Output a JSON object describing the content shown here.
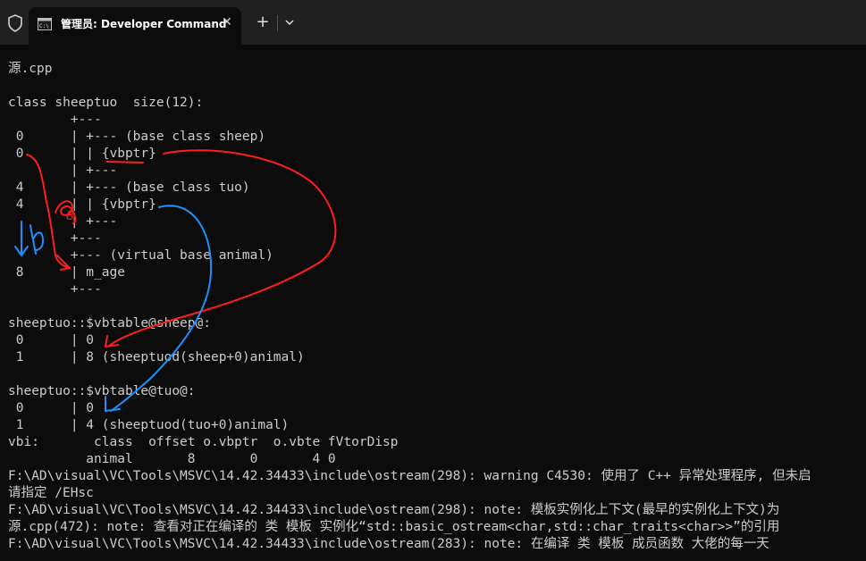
{
  "tab": {
    "title": "管理员: Developer Command",
    "close_glyph": "✕",
    "new_tab_glyph": "+"
  },
  "console_lines": [
    "",
    "源.cpp",
    "",
    "class sheeptuo  size(12):",
    "        +---",
    " 0      | +--- (base class sheep)",
    " 0      | | {vbptr}",
    "        | +---",
    " 4      | +--- (base class tuo)",
    " 4      | | {vbptr}",
    "        | +---",
    "        +---",
    "        +--- (virtual base animal)",
    " 8      | m_age",
    "        +---",
    "",
    "sheeptuo::$vbtable@sheep@:",
    " 0      | 0",
    " 1      | 8 (sheeptuod(sheep+0)animal)",
    "",
    "sheeptuo::$vbtable@tuo@:",
    " 0      | 0",
    " 1      | 4 (sheeptuod(tuo+0)animal)",
    "vbi:       class  offset o.vbptr  o.vbte fVtorDisp",
    "          animal       8       0       4 0",
    "F:\\AD\\visual\\VC\\Tools\\MSVC\\14.42.34433\\include\\ostream(298): warning C4530: 使用了 C++ 异常处理程序, 但未启",
    "请指定 /EHsc",
    "F:\\AD\\visual\\VC\\Tools\\MSVC\\14.42.34433\\include\\ostream(298): note: 模板实例化上下文(最早的实例化上下文)为",
    "源.cpp(472): note: 查看对正在编译的 类 模板 实例化“std::basic_ostream<char,std::char_traits<char>>”的引用",
    "F:\\AD\\visual\\VC\\Tools\\MSVC\\14.42.34433\\include\\ostream(283): note: 在编译 类 模板 成员函数 大佬的每一天"
  ],
  "annotations": {
    "handwritten_label": "8",
    "red_color": "#ff1e1e",
    "blue_color": "#1e90ff"
  },
  "colors": {
    "console_bg": "#0c0c0c",
    "tabbar_bg": "#202020",
    "text": "#cccccc"
  }
}
